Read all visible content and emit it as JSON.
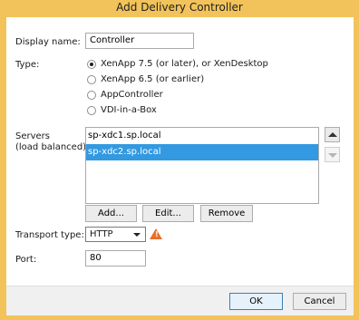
{
  "window": {
    "title": "Add Delivery Controller"
  },
  "display_name": {
    "label": "Display name:",
    "value": "Controller"
  },
  "type": {
    "label": "Type:",
    "options": [
      {
        "label": "XenApp 7.5 (or later), or XenDesktop",
        "selected": true
      },
      {
        "label": "XenApp 6.5 (or earlier)",
        "selected": false
      },
      {
        "label": "AppController",
        "selected": false
      },
      {
        "label": "VDI-in-a-Box",
        "selected": false
      }
    ]
  },
  "servers": {
    "label_line1": "Servers",
    "label_line2": "(load balanced):",
    "items": [
      "sp-xdc1.sp.local",
      "sp-xdc2.sp.local"
    ],
    "selected_index": 1,
    "add_label": "Add...",
    "edit_label": "Edit...",
    "remove_label": "Remove"
  },
  "transport": {
    "label": "Transport type:",
    "value": "HTTP",
    "warning_icon": "warning-icon"
  },
  "port": {
    "label": "Port:",
    "value": "80"
  },
  "footer": {
    "ok_label": "OK",
    "cancel_label": "Cancel"
  },
  "colors": {
    "frame": "#f2c35a",
    "selection": "#3399e0",
    "warning": "#e8702a"
  }
}
